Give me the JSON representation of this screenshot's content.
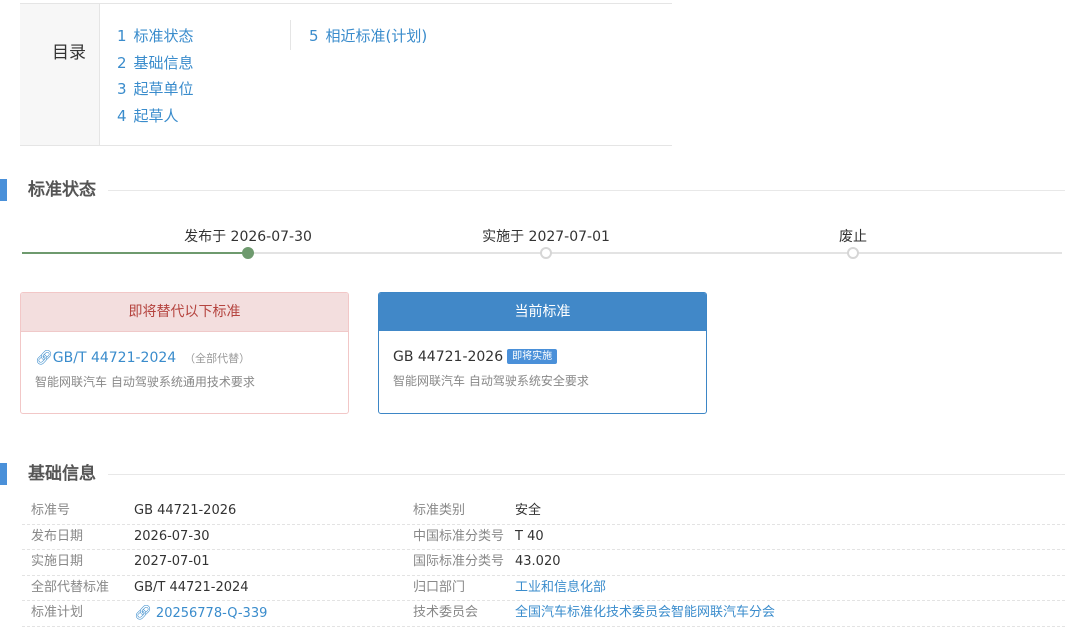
{
  "toc": {
    "title": "目录",
    "items": [
      {
        "num": "1",
        "label": "标准状态"
      },
      {
        "num": "2",
        "label": "基础信息"
      },
      {
        "num": "3",
        "label": "起草单位"
      },
      {
        "num": "4",
        "label": "起草人"
      }
    ],
    "items_col2": [
      {
        "num": "5",
        "label": "相近标准(计划)"
      }
    ]
  },
  "status_section": {
    "title": "标准状态",
    "timeline": [
      {
        "label": "发布于 2026-07-30",
        "state": "done"
      },
      {
        "label": "实施于 2027-07-01",
        "state": "pending"
      },
      {
        "label": "废止",
        "state": "pending"
      }
    ],
    "progress_percent": 22
  },
  "cards": {
    "replace": {
      "header": "即将替代以下标准",
      "link_icon": "link-icon",
      "std_number": "GB/T 44721-2024",
      "note": "（全部代替）",
      "description": "智能网联汽车 自动驾驶系统通用技术要求"
    },
    "current": {
      "header": "当前标准",
      "std_number": "GB 44721-2026",
      "badge": "即将实施",
      "description": "智能网联汽车 自动驾驶系统安全要求"
    }
  },
  "basic_section": {
    "title": "基础信息",
    "rows": [
      {
        "k1": "标准号",
        "v1": "GB 44721-2026",
        "k2": "标准类别",
        "v2": "安全"
      },
      {
        "k1": "发布日期",
        "v1": "2026-07-30",
        "k2": "中国标准分类号",
        "v2": "T 40"
      },
      {
        "k1": "实施日期",
        "v1": "2027-07-01",
        "k2": "国际标准分类号",
        "v2": "43.020"
      },
      {
        "k1": "全部代替标准",
        "v1": "GB/T 44721-2024",
        "k2": "归口部门",
        "v2": "工业和信息化部"
      },
      {
        "k1": "标准计划",
        "v1": "20256778-Q-339",
        "k2": "技术委员会",
        "v2": "全国汽车标准化技术委员会智能网联汽车分会"
      }
    ]
  },
  "colors": {
    "accent_blue": "#4a90d9",
    "link_blue": "#3a8ccc",
    "timeline_green": "#6e9a6e",
    "replace_header_bg": "#f3dede",
    "replace_header_text": "#b5443f"
  }
}
